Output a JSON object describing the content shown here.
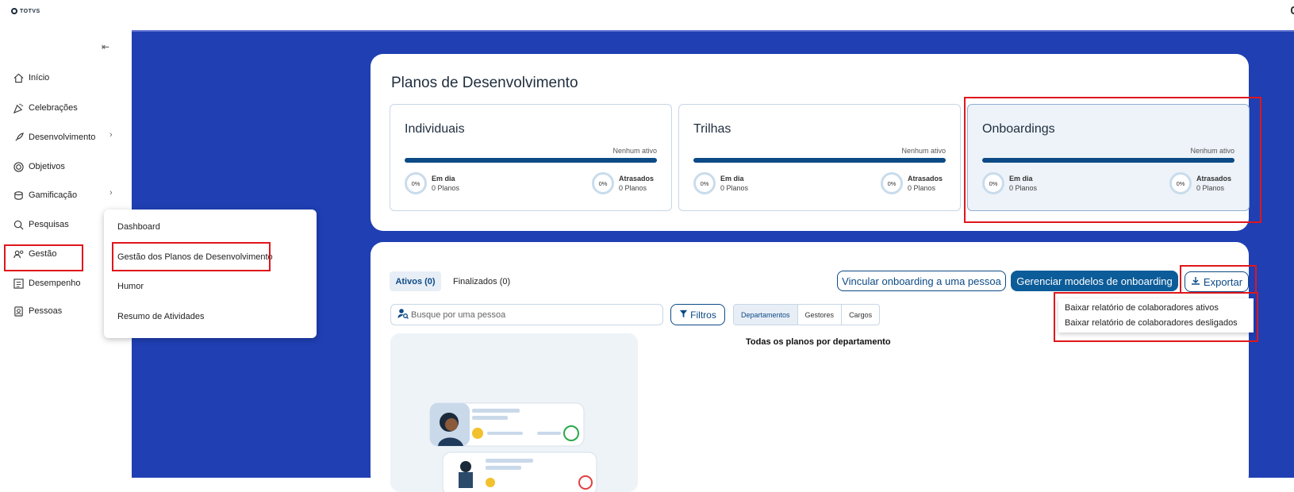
{
  "brand": {
    "logo_text": "TOTVS"
  },
  "sidebar": {
    "items": [
      {
        "label": "Início",
        "icon": "home-icon",
        "chevron": false
      },
      {
        "label": "Celebrações",
        "icon": "party-icon",
        "chevron": false
      },
      {
        "label": "Desenvolvimento",
        "icon": "rocket-icon",
        "chevron": true
      },
      {
        "label": "Objetivos",
        "icon": "target-icon",
        "chevron": false
      },
      {
        "label": "Gamificação",
        "icon": "coins-icon",
        "chevron": true
      },
      {
        "label": "Pesquisas",
        "icon": "search-chart-icon",
        "chevron": false
      },
      {
        "label": "Gestão",
        "icon": "people-gear-icon",
        "chevron": false
      },
      {
        "label": "Desempenho",
        "icon": "list-icon",
        "chevron": false
      },
      {
        "label": "Pessoas",
        "icon": "badge-icon",
        "chevron": false
      }
    ]
  },
  "flyout": {
    "items": [
      "Dashboard",
      "Gestão dos Planos de Desenvolvimento",
      "Humor",
      "Resumo de Atividades"
    ]
  },
  "plans": {
    "title": "Planos de Desenvolvimento",
    "cards": [
      {
        "title": "Individuais",
        "status": "Nenhum ativo",
        "ontime_pct": "0%",
        "ontime_label": "Em dia",
        "ontime_count": "0 Planos",
        "late_pct": "0%",
        "late_label": "Atrasados",
        "late_count": "0 Planos"
      },
      {
        "title": "Trilhas",
        "status": "Nenhum ativo",
        "ontime_pct": "0%",
        "ontime_label": "Em dia",
        "ontime_count": "0 Planos",
        "late_pct": "0%",
        "late_label": "Atrasados",
        "late_count": "0 Planos"
      },
      {
        "title": "Onboardings",
        "status": "Nenhum ativo",
        "ontime_pct": "0%",
        "ontime_label": "Em dia",
        "ontime_count": "0 Planos",
        "late_pct": "0%",
        "late_label": "Atrasados",
        "late_count": "0 Planos"
      }
    ]
  },
  "list": {
    "tab_active": "Ativos (0)",
    "tab_finished": "Finalizados (0)",
    "link_button": "Vincular onboarding a uma pessoa",
    "manage_button": "Gerenciar modelos de onboarding",
    "export_button": "Exportar",
    "search_placeholder": "Busque por uma pessoa",
    "filters_button": "Filtros",
    "segments": [
      "Departamentos",
      "Gestores",
      "Cargos"
    ],
    "chart_title": "Todas os planos por departamento"
  },
  "export_menu": {
    "items": [
      "Baixar relatório de colaboradores ativos",
      "Baixar relatório de colaboradores desligados"
    ]
  },
  "colors": {
    "primary": "#0c4a86",
    "background": "#1f3fb3",
    "highlight": "#e0161b"
  }
}
